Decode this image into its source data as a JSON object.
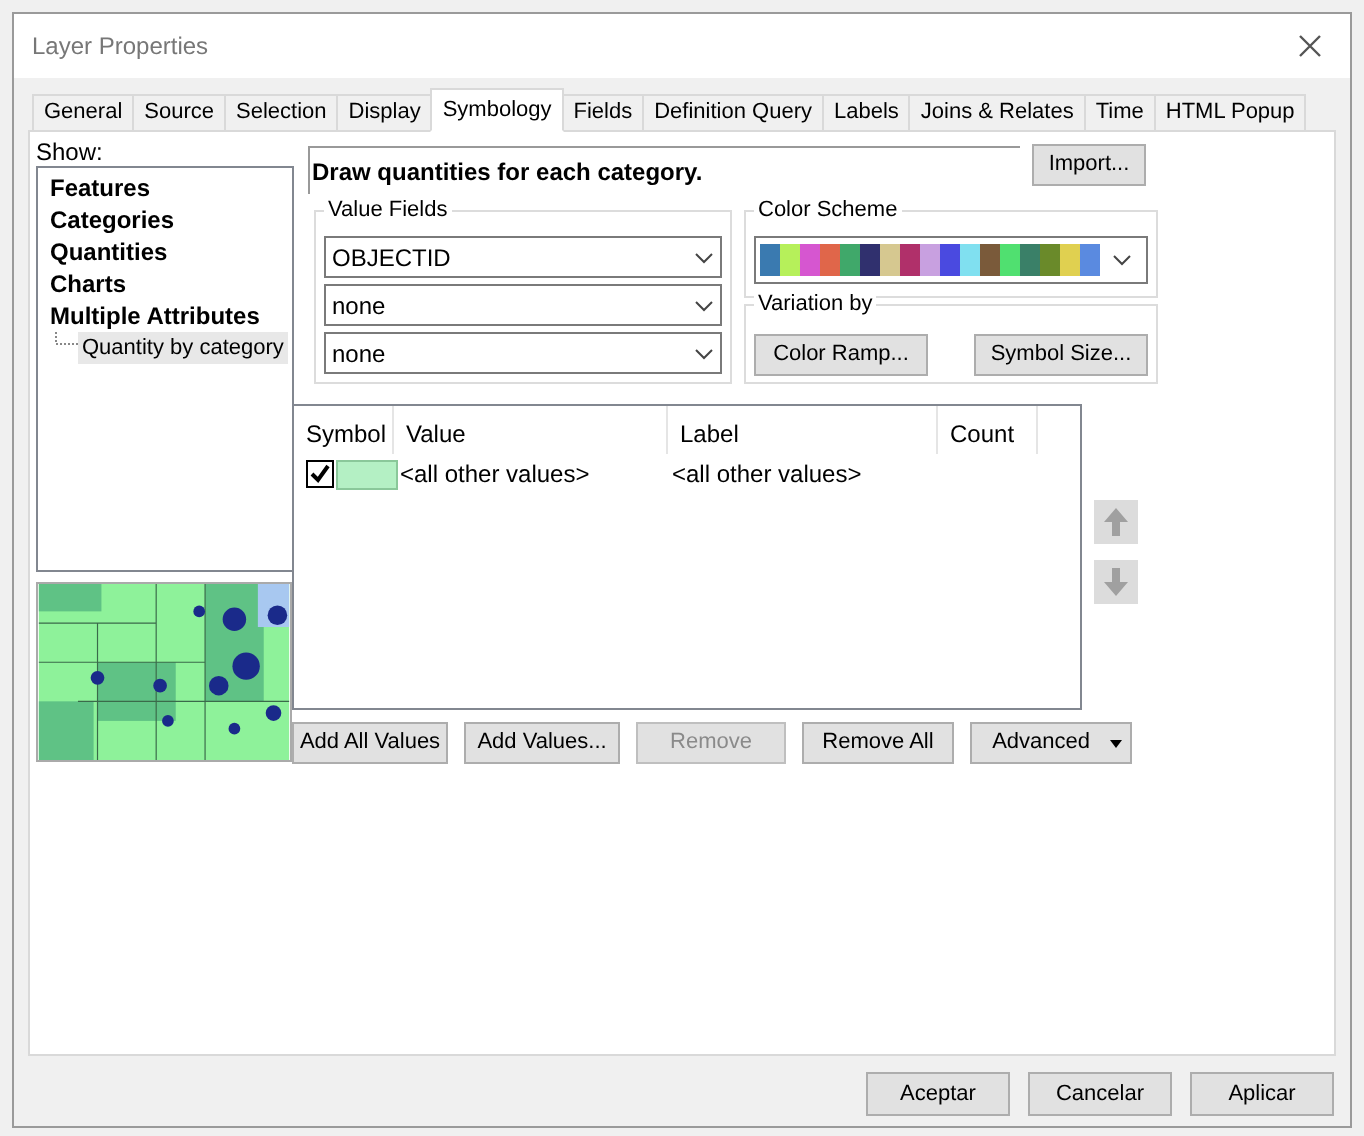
{
  "window": {
    "title": "Layer Properties"
  },
  "tabs": [
    {
      "label": "General",
      "selected": false
    },
    {
      "label": "Source",
      "selected": false
    },
    {
      "label": "Selection",
      "selected": false
    },
    {
      "label": "Display",
      "selected": false
    },
    {
      "label": "Symbology",
      "selected": true
    },
    {
      "label": "Fields",
      "selected": false
    },
    {
      "label": "Definition Query",
      "selected": false
    },
    {
      "label": "Labels",
      "selected": false
    },
    {
      "label": "Joins & Relates",
      "selected": false
    },
    {
      "label": "Time",
      "selected": false
    },
    {
      "label": "HTML Popup",
      "selected": false
    }
  ],
  "show": {
    "label": "Show:",
    "items": [
      {
        "label": "Features"
      },
      {
        "label": "Categories"
      },
      {
        "label": "Quantities"
      },
      {
        "label": "Charts"
      },
      {
        "label": "Multiple Attributes",
        "children": [
          {
            "label": "Quantity by category",
            "selected": true
          }
        ]
      }
    ]
  },
  "heading": "Draw quantities for each category.",
  "import_button": "Import...",
  "value_fields": {
    "label": "Value Fields",
    "dropdowns": [
      "OBJECTID",
      "none",
      "none"
    ]
  },
  "color_scheme": {
    "label": "Color Scheme"
  },
  "variation": {
    "label": "Variation by",
    "buttons": [
      "Color Ramp...",
      "Symbol Size..."
    ]
  },
  "table": {
    "columns": [
      "Symbol",
      "Value",
      "Label",
      "Count"
    ],
    "rows": [
      {
        "checked": true,
        "value": "<all other values>",
        "label": "<all other values>"
      }
    ]
  },
  "buttons": [
    {
      "label": "Add All Values",
      "disabled": false,
      "kind": "plain"
    },
    {
      "label": "Add Values...",
      "disabled": false,
      "kind": "plain"
    },
    {
      "label": "Remove",
      "disabled": true,
      "kind": "plain"
    },
    {
      "label": "Remove All",
      "disabled": false,
      "kind": "plain"
    },
    {
      "label": "Advanced",
      "disabled": false,
      "kind": "menu"
    }
  ],
  "dialog_buttons": [
    "Aceptar",
    "Cancelar",
    "Aplicar"
  ]
}
